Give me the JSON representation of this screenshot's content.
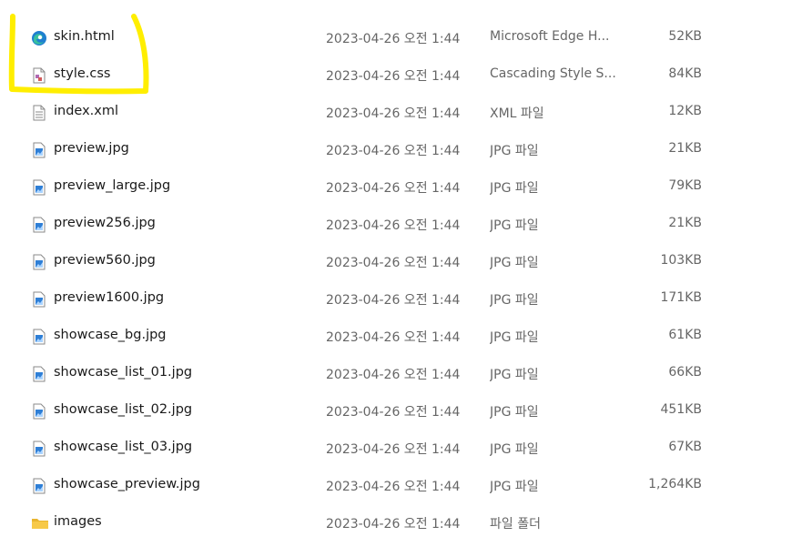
{
  "files": [
    {
      "name": "skin.html",
      "date": "2023-04-26 오전 1:44",
      "type": "Microsoft Edge H...",
      "size": "52KB",
      "icon": "edge-icon"
    },
    {
      "name": "style.css",
      "date": "2023-04-26 오전 1:44",
      "type": "Cascading Style S...",
      "size": "84KB",
      "icon": "css-file-icon"
    },
    {
      "name": "index.xml",
      "date": "2023-04-26 오전 1:44",
      "type": "XML 파일",
      "size": "12KB",
      "icon": "xml-file-icon"
    },
    {
      "name": "preview.jpg",
      "date": "2023-04-26 오전 1:44",
      "type": "JPG 파일",
      "size": "21KB",
      "icon": "image-file-icon"
    },
    {
      "name": "preview_large.jpg",
      "date": "2023-04-26 오전 1:44",
      "type": "JPG 파일",
      "size": "79KB",
      "icon": "image-file-icon"
    },
    {
      "name": "preview256.jpg",
      "date": "2023-04-26 오전 1:44",
      "type": "JPG 파일",
      "size": "21KB",
      "icon": "image-file-icon"
    },
    {
      "name": "preview560.jpg",
      "date": "2023-04-26 오전 1:44",
      "type": "JPG 파일",
      "size": "103KB",
      "icon": "image-file-icon"
    },
    {
      "name": "preview1600.jpg",
      "date": "2023-04-26 오전 1:44",
      "type": "JPG 파일",
      "size": "171KB",
      "icon": "image-file-icon"
    },
    {
      "name": "showcase_bg.jpg",
      "date": "2023-04-26 오전 1:44",
      "type": "JPG 파일",
      "size": "61KB",
      "icon": "image-file-icon"
    },
    {
      "name": "showcase_list_01.jpg",
      "date": "2023-04-26 오전 1:44",
      "type": "JPG 파일",
      "size": "66KB",
      "icon": "image-file-icon"
    },
    {
      "name": "showcase_list_02.jpg",
      "date": "2023-04-26 오전 1:44",
      "type": "JPG 파일",
      "size": "451KB",
      "icon": "image-file-icon"
    },
    {
      "name": "showcase_list_03.jpg",
      "date": "2023-04-26 오전 1:44",
      "type": "JPG 파일",
      "size": "67KB",
      "icon": "image-file-icon"
    },
    {
      "name": "showcase_preview.jpg",
      "date": "2023-04-26 오전 1:44",
      "type": "JPG 파일",
      "size": "1,264KB",
      "icon": "image-file-icon"
    },
    {
      "name": "images",
      "date": "2023-04-26 오전 1:44",
      "type": "파일 폴더",
      "size": "",
      "icon": "folder-icon"
    }
  ],
  "colors": {
    "highlight": "#ffee00",
    "name_text": "#1a1a1a",
    "detail_text": "#666666",
    "folder": "#f5c342",
    "image_blue": "#2f7fd6"
  }
}
